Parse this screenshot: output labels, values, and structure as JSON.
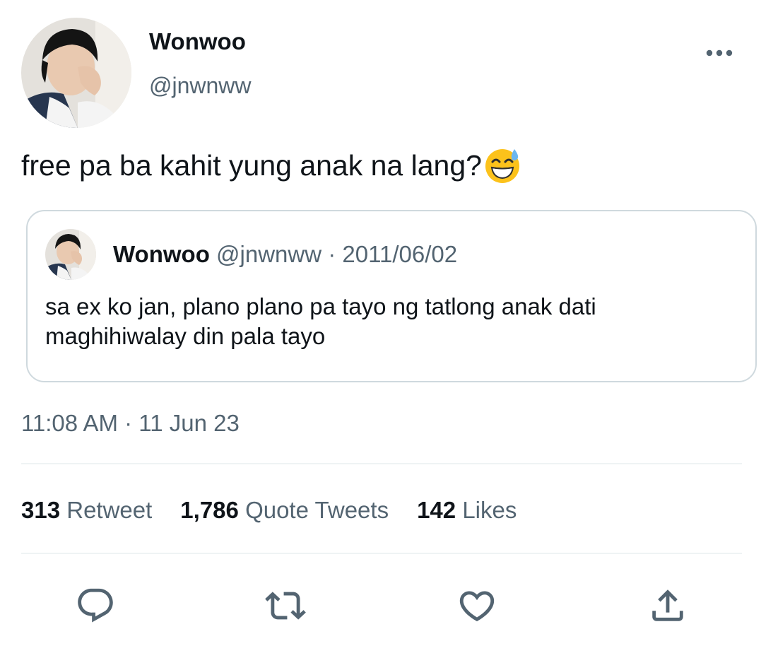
{
  "tweet": {
    "author": {
      "display_name": "Wonwoo",
      "handle": "@jnwnww"
    },
    "text": "free pa ba kahit yung anak na lang?",
    "emoji": "grinning-face-with-sweat",
    "timestamp": "11:08 AM · 11 Jun 23"
  },
  "quoted_tweet": {
    "display_name": "Wonwoo",
    "meta": "@jnwnww · 2011/06/02",
    "line1": "sa ex ko jan, plano plano pa tayo ng tatlong anak dati",
    "line2": "maghihiwalay din pala tayo"
  },
  "stats": {
    "retweets_count": "313",
    "retweets_label": "Retweet",
    "quotes_count": "1,786",
    "quotes_label": "Quote Tweets",
    "likes_count": "142",
    "likes_label": "Likes"
  },
  "actions": [
    {
      "icon": "reply-icon"
    },
    {
      "icon": "retweet-icon"
    },
    {
      "icon": "like-icon"
    },
    {
      "icon": "share-icon"
    }
  ],
  "colors": {
    "text_primary": "#0f1419",
    "text_secondary": "#536471",
    "border": "#cfd9de",
    "divider": "#eff3f4"
  }
}
